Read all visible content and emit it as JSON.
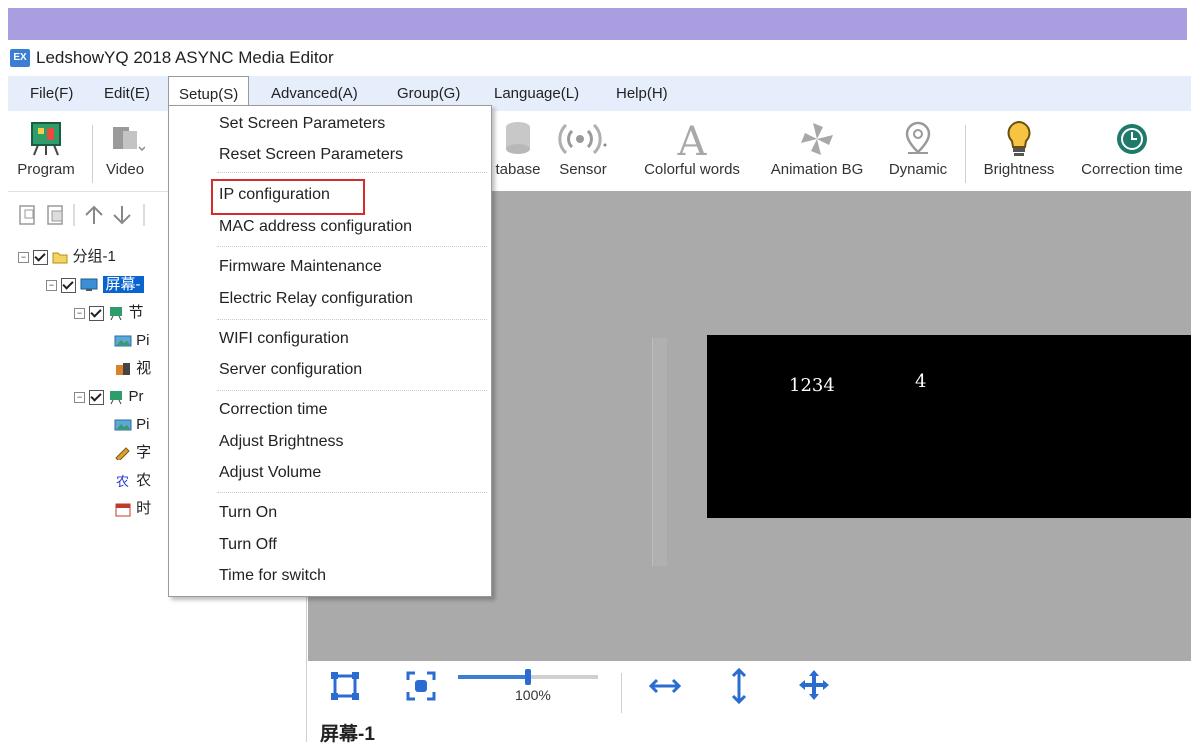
{
  "window": {
    "title": "LedshowYQ 2018 ASYNC Media Editor",
    "app_icon": "EX"
  },
  "menubar": {
    "items": [
      "File(F)",
      "Edit(E)",
      "Setup(S)",
      "Advanced(A)",
      "Group(G)",
      "Language(L)",
      "Help(H)"
    ],
    "active": "Setup(S)"
  },
  "toolbar": {
    "program": "Program",
    "video": "Video",
    "database": "tabase",
    "sensor": "Sensor",
    "colorful_words": "Colorful words",
    "animation_bg": "Animation BG",
    "dynamic": "Dynamic",
    "brightness": "Brightness",
    "correction_time": "Correction time"
  },
  "setup_menu": {
    "items": [
      "Set Screen Parameters",
      "Reset Screen Parameters",
      "IP configuration",
      "MAC address configuration",
      "Firmware Maintenance",
      "Electric Relay configuration",
      "WIFI configuration",
      "Server configuration",
      "Correction time",
      "Adjust Brightness",
      "Adjust Volume",
      "Turn On",
      "Turn Off",
      "Time for switch"
    ],
    "highlighted": "IP configuration"
  },
  "tree": {
    "group": "分组-1",
    "screen": "屏幕-",
    "program1": "节",
    "program1_children": [
      "Pi",
      "视"
    ],
    "program2": "Pr",
    "program2_children": [
      "Pi",
      "字",
      "农",
      "时"
    ]
  },
  "canvas": {
    "led_values": [
      "1234",
      "4"
    ],
    "colors": {
      "background": "#aaaaaa",
      "led": "#000000"
    }
  },
  "bottombar": {
    "zoom_percent": 100,
    "zoom_label": "100%",
    "screen_label": "屏幕-1"
  }
}
